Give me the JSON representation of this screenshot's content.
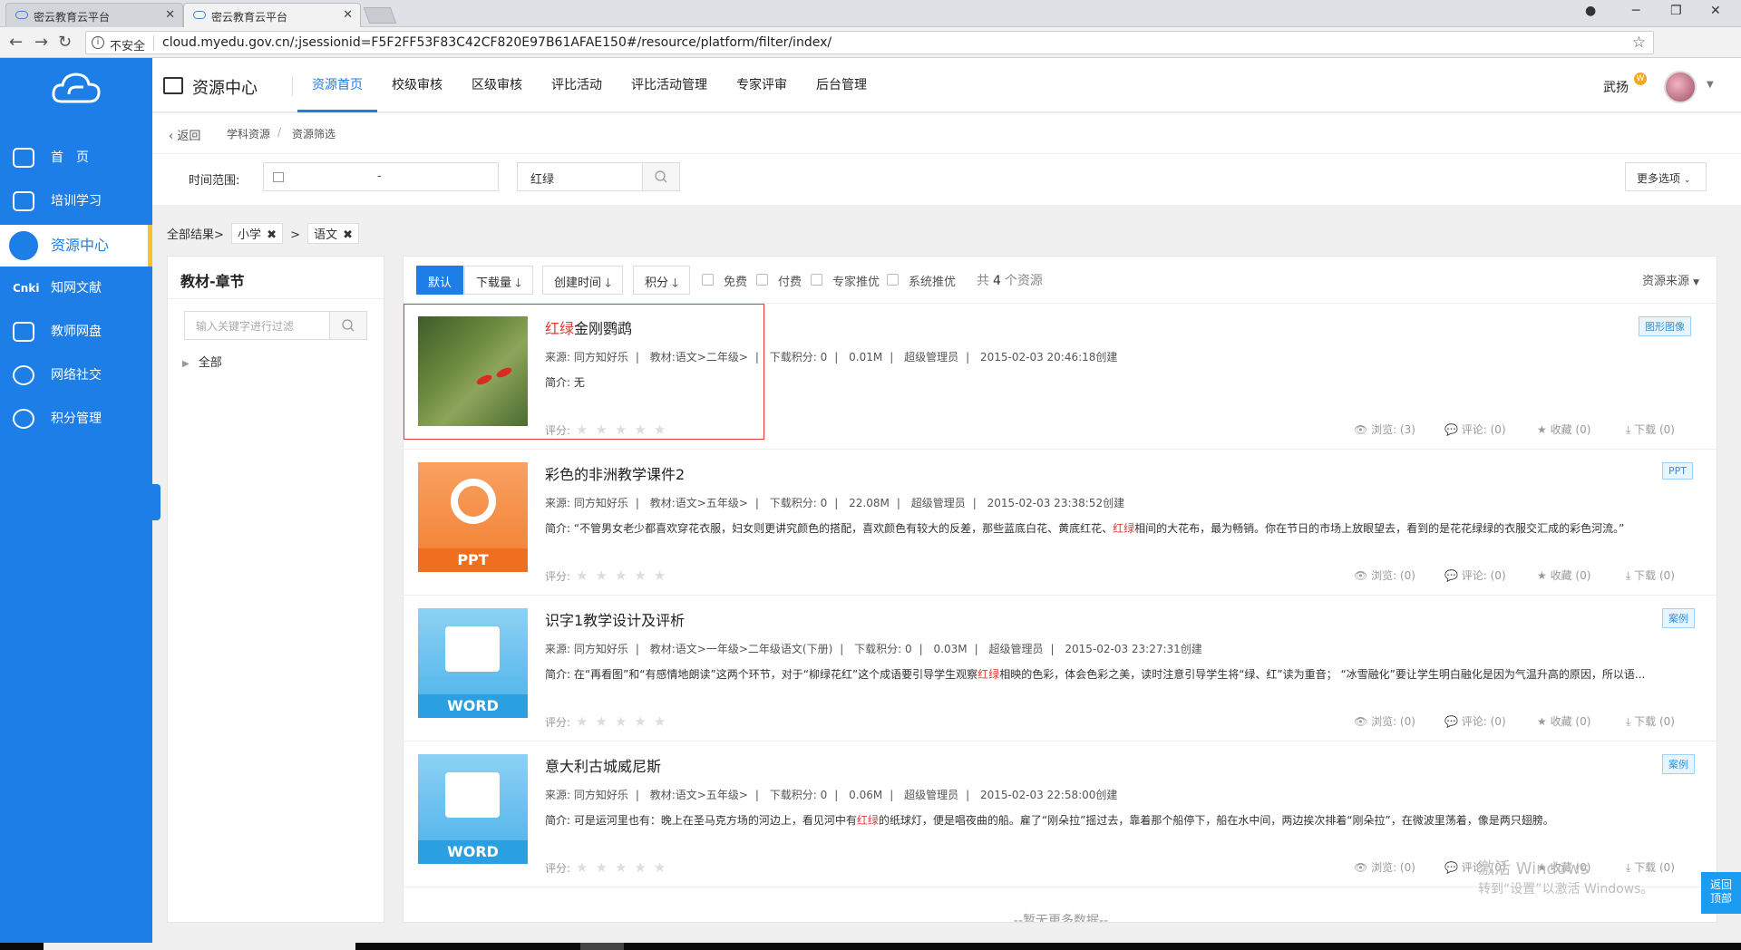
{
  "browser": {
    "tabs": [
      {
        "title": "密云教育云平台"
      },
      {
        "title": "密云教育云平台"
      }
    ],
    "insecure_label": "不安全",
    "url": "cloud.myedu.gov.cn/;jsessionid=F5F2FF53F83C42CF820E97B61AFAE150#/resource/platform/filter/index/"
  },
  "sidebar": {
    "items": [
      {
        "label": "首　页",
        "icon": "home-icon"
      },
      {
        "label": "培训学习",
        "icon": "training-icon"
      },
      {
        "label": "资源中心",
        "icon": "resource-icon",
        "active": true
      },
      {
        "label": "知网文献",
        "icon": "cnki-icon"
      },
      {
        "label": "教师网盘",
        "icon": "disk-icon"
      },
      {
        "label": "网络社交",
        "icon": "social-icon"
      },
      {
        "label": "积分管理",
        "icon": "points-icon"
      }
    ],
    "cnki_text": "Cnki"
  },
  "topnav": {
    "title": "资源中心",
    "menus": [
      "资源首页",
      "校级审核",
      "区级审核",
      "评比活动",
      "评比活动管理",
      "专家评审",
      "后台管理"
    ],
    "user": "武扬",
    "user_badge": "W"
  },
  "breadcrumb": {
    "back": "返回",
    "items": [
      "学科资源",
      "资源筛选"
    ],
    "sep": "/"
  },
  "filter": {
    "time_label": "时间范围:",
    "date_sep": "-",
    "keyword": "红绿",
    "more": "更多选项"
  },
  "tags": {
    "all": "全部结果>",
    "items": [
      "小学",
      "语文"
    ],
    "sep": ">"
  },
  "leftpanel": {
    "title": "教材-章节",
    "search_placeholder": "输入关键字进行过滤",
    "tree_root": "全部"
  },
  "sortbar": {
    "buttons": [
      "默认",
      "下载量",
      "创建时间",
      "积分"
    ],
    "checks": [
      "免费",
      "付费",
      "专家推优",
      "系统推优"
    ],
    "total_prefix": "共",
    "total_count": "4",
    "total_suffix": "个资源",
    "source": "资源来源"
  },
  "items": [
    {
      "title_hl": "红绿",
      "title_rest": "金刚鹦鹉",
      "source": "来源:  同方知好乐",
      "book": "教材:语文>二年级>",
      "points": "下载积分: 0",
      "size": "0.01M",
      "uploader": "超级管理员",
      "created": "2015-02-03 20:46:18创建",
      "desc_pre": "简介:  无",
      "desc_hl": "",
      "desc_post": "",
      "badge": "图形图像",
      "thumb": "photo",
      "views": "浏览: (3)",
      "comments": "评论: (0)",
      "favs": "收藏 (0)",
      "downloads": "下载 (0)"
    },
    {
      "title_hl": "",
      "title_rest": "彩色的非洲教学课件2",
      "source": "来源:  同方知好乐",
      "book": "教材:语文>五年级>",
      "points": "下载积分: 0",
      "size": "22.08M",
      "uploader": "超级管理员",
      "created": "2015-02-03 23:38:52创建",
      "desc_pre": "简介:  “不管男女老少都喜欢穿花衣服，妇女则更讲究颜色的搭配，喜欢颜色有较大的反差，那些蓝底白花、黄底红花、",
      "desc_hl": "红绿",
      "desc_post": "相间的大花布，最为畅销。你在节日的市场上放眼望去，看到的是花花绿绿的衣服交汇成的彩色河流。”",
      "badge": "PPT",
      "thumb": "ppt",
      "band": "PPT",
      "views": "浏览: (0)",
      "comments": "评论: (0)",
      "favs": "收藏 (0)",
      "downloads": "下载 (0)"
    },
    {
      "title_hl": "",
      "title_rest": "识字1教学设计及评析",
      "source": "来源:  同方知好乐",
      "book": "教材:语文>一年级>二年级语文(下册)",
      "points": "下载积分: 0",
      "size": "0.03M",
      "uploader": "超级管理员",
      "created": "2015-02-03 23:27:31创建",
      "desc_pre": "简介: 在“再看图”和“有感情地朗读”这两个环节，对于“柳绿花红”这个成语要引导学生观察",
      "desc_hl": "红绿",
      "desc_post": "相映的色彩，体会色彩之美，读时注意引导学生将“绿、红”读为重音； “冰雪融化”要让学生明白融化是因为气温升高的原因，所以语...",
      "badge": "案例",
      "thumb": "word",
      "band": "WORD",
      "views": "浏览: (0)",
      "comments": "评论: (0)",
      "favs": "收藏 (0)",
      "downloads": "下载 (0)"
    },
    {
      "title_hl": "",
      "title_rest": "意大利古城威尼斯",
      "source": "来源:  同方知好乐",
      "book": "教材:语文>五年级>",
      "points": "下载积分: 0",
      "size": "0.06M",
      "uploader": "超级管理员",
      "created": "2015-02-03 22:58:00创建",
      "desc_pre": "简介: 可是运河里也有：晚上在圣马克方场的河边上，看见河中有",
      "desc_hl": "红绿",
      "desc_post": "的纸球灯，便是唱夜曲的船。雇了“刚朵拉”摇过去，靠着那个船停下，船在水中间，两边挨次排着“刚朵拉”，在微波里荡着，像是两只翅膀。",
      "badge": "案例",
      "thumb": "word",
      "band": "WORD",
      "views": "浏览: (0)",
      "comments": "评论: (0)",
      "favs": "收藏 (0)",
      "downloads": "下载 (0)"
    }
  ],
  "rating_label": "评分:",
  "nomore": "--暂无更多数据--",
  "watermark": {
    "line1": "激活 Windows",
    "line2": "转到“设置”以激活 Windows。"
  },
  "backtop": {
    "line1": "返回",
    "line2": "顶部"
  },
  "colors": {
    "primary": "#1c7ee6",
    "highlight": "#e53935",
    "accent": "#f6c030"
  }
}
